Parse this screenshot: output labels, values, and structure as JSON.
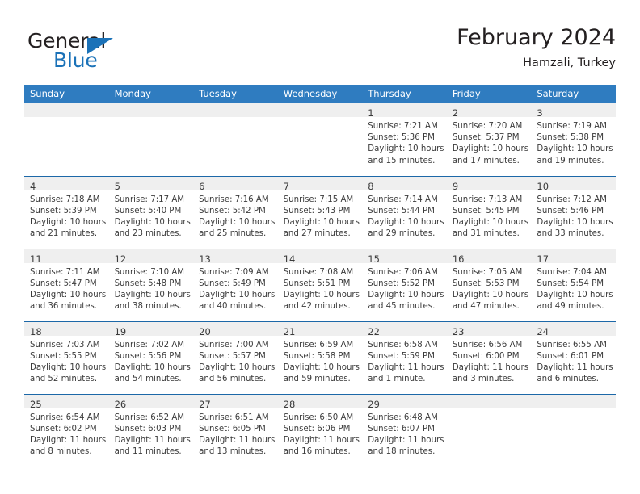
{
  "brand": {
    "name_part1": "General",
    "name_part2": "Blue",
    "logo_icon": "triangle-flag-icon"
  },
  "header": {
    "title": "February 2024",
    "subtitle": "Hamzali, Turkey"
  },
  "colors": {
    "header_blue": "#2f7cc0",
    "row_separator_blue": "#1c68a8",
    "daynum_strip_gray": "#efefef",
    "brand_blue": "#1b72b8",
    "text": "#3b3b3b"
  },
  "weekday_headers": [
    "Sunday",
    "Monday",
    "Tuesday",
    "Wednesday",
    "Thursday",
    "Friday",
    "Saturday"
  ],
  "weeks": [
    [
      {
        "day": "",
        "lines": []
      },
      {
        "day": "",
        "lines": []
      },
      {
        "day": "",
        "lines": []
      },
      {
        "day": "",
        "lines": []
      },
      {
        "day": "1",
        "lines": [
          "Sunrise: 7:21 AM",
          "Sunset: 5:36 PM",
          "Daylight: 10 hours",
          "and 15 minutes."
        ]
      },
      {
        "day": "2",
        "lines": [
          "Sunrise: 7:20 AM",
          "Sunset: 5:37 PM",
          "Daylight: 10 hours",
          "and 17 minutes."
        ]
      },
      {
        "day": "3",
        "lines": [
          "Sunrise: 7:19 AM",
          "Sunset: 5:38 PM",
          "Daylight: 10 hours",
          "and 19 minutes."
        ]
      }
    ],
    [
      {
        "day": "4",
        "lines": [
          "Sunrise: 7:18 AM",
          "Sunset: 5:39 PM",
          "Daylight: 10 hours",
          "and 21 minutes."
        ]
      },
      {
        "day": "5",
        "lines": [
          "Sunrise: 7:17 AM",
          "Sunset: 5:40 PM",
          "Daylight: 10 hours",
          "and 23 minutes."
        ]
      },
      {
        "day": "6",
        "lines": [
          "Sunrise: 7:16 AM",
          "Sunset: 5:42 PM",
          "Daylight: 10 hours",
          "and 25 minutes."
        ]
      },
      {
        "day": "7",
        "lines": [
          "Sunrise: 7:15 AM",
          "Sunset: 5:43 PM",
          "Daylight: 10 hours",
          "and 27 minutes."
        ]
      },
      {
        "day": "8",
        "lines": [
          "Sunrise: 7:14 AM",
          "Sunset: 5:44 PM",
          "Daylight: 10 hours",
          "and 29 minutes."
        ]
      },
      {
        "day": "9",
        "lines": [
          "Sunrise: 7:13 AM",
          "Sunset: 5:45 PM",
          "Daylight: 10 hours",
          "and 31 minutes."
        ]
      },
      {
        "day": "10",
        "lines": [
          "Sunrise: 7:12 AM",
          "Sunset: 5:46 PM",
          "Daylight: 10 hours",
          "and 33 minutes."
        ]
      }
    ],
    [
      {
        "day": "11",
        "lines": [
          "Sunrise: 7:11 AM",
          "Sunset: 5:47 PM",
          "Daylight: 10 hours",
          "and 36 minutes."
        ]
      },
      {
        "day": "12",
        "lines": [
          "Sunrise: 7:10 AM",
          "Sunset: 5:48 PM",
          "Daylight: 10 hours",
          "and 38 minutes."
        ]
      },
      {
        "day": "13",
        "lines": [
          "Sunrise: 7:09 AM",
          "Sunset: 5:49 PM",
          "Daylight: 10 hours",
          "and 40 minutes."
        ]
      },
      {
        "day": "14",
        "lines": [
          "Sunrise: 7:08 AM",
          "Sunset: 5:51 PM",
          "Daylight: 10 hours",
          "and 42 minutes."
        ]
      },
      {
        "day": "15",
        "lines": [
          "Sunrise: 7:06 AM",
          "Sunset: 5:52 PM",
          "Daylight: 10 hours",
          "and 45 minutes."
        ]
      },
      {
        "day": "16",
        "lines": [
          "Sunrise: 7:05 AM",
          "Sunset: 5:53 PM",
          "Daylight: 10 hours",
          "and 47 minutes."
        ]
      },
      {
        "day": "17",
        "lines": [
          "Sunrise: 7:04 AM",
          "Sunset: 5:54 PM",
          "Daylight: 10 hours",
          "and 49 minutes."
        ]
      }
    ],
    [
      {
        "day": "18",
        "lines": [
          "Sunrise: 7:03 AM",
          "Sunset: 5:55 PM",
          "Daylight: 10 hours",
          "and 52 minutes."
        ]
      },
      {
        "day": "19",
        "lines": [
          "Sunrise: 7:02 AM",
          "Sunset: 5:56 PM",
          "Daylight: 10 hours",
          "and 54 minutes."
        ]
      },
      {
        "day": "20",
        "lines": [
          "Sunrise: 7:00 AM",
          "Sunset: 5:57 PM",
          "Daylight: 10 hours",
          "and 56 minutes."
        ]
      },
      {
        "day": "21",
        "lines": [
          "Sunrise: 6:59 AM",
          "Sunset: 5:58 PM",
          "Daylight: 10 hours",
          "and 59 minutes."
        ]
      },
      {
        "day": "22",
        "lines": [
          "Sunrise: 6:58 AM",
          "Sunset: 5:59 PM",
          "Daylight: 11 hours",
          "and 1 minute."
        ]
      },
      {
        "day": "23",
        "lines": [
          "Sunrise: 6:56 AM",
          "Sunset: 6:00 PM",
          "Daylight: 11 hours",
          "and 3 minutes."
        ]
      },
      {
        "day": "24",
        "lines": [
          "Sunrise: 6:55 AM",
          "Sunset: 6:01 PM",
          "Daylight: 11 hours",
          "and 6 minutes."
        ]
      }
    ],
    [
      {
        "day": "25",
        "lines": [
          "Sunrise: 6:54 AM",
          "Sunset: 6:02 PM",
          "Daylight: 11 hours",
          "and 8 minutes."
        ]
      },
      {
        "day": "26",
        "lines": [
          "Sunrise: 6:52 AM",
          "Sunset: 6:03 PM",
          "Daylight: 11 hours",
          "and 11 minutes."
        ]
      },
      {
        "day": "27",
        "lines": [
          "Sunrise: 6:51 AM",
          "Sunset: 6:05 PM",
          "Daylight: 11 hours",
          "and 13 minutes."
        ]
      },
      {
        "day": "28",
        "lines": [
          "Sunrise: 6:50 AM",
          "Sunset: 6:06 PM",
          "Daylight: 11 hours",
          "and 16 minutes."
        ]
      },
      {
        "day": "29",
        "lines": [
          "Sunrise: 6:48 AM",
          "Sunset: 6:07 PM",
          "Daylight: 11 hours",
          "and 18 minutes."
        ]
      },
      {
        "day": "",
        "lines": []
      },
      {
        "day": "",
        "lines": []
      }
    ]
  ]
}
